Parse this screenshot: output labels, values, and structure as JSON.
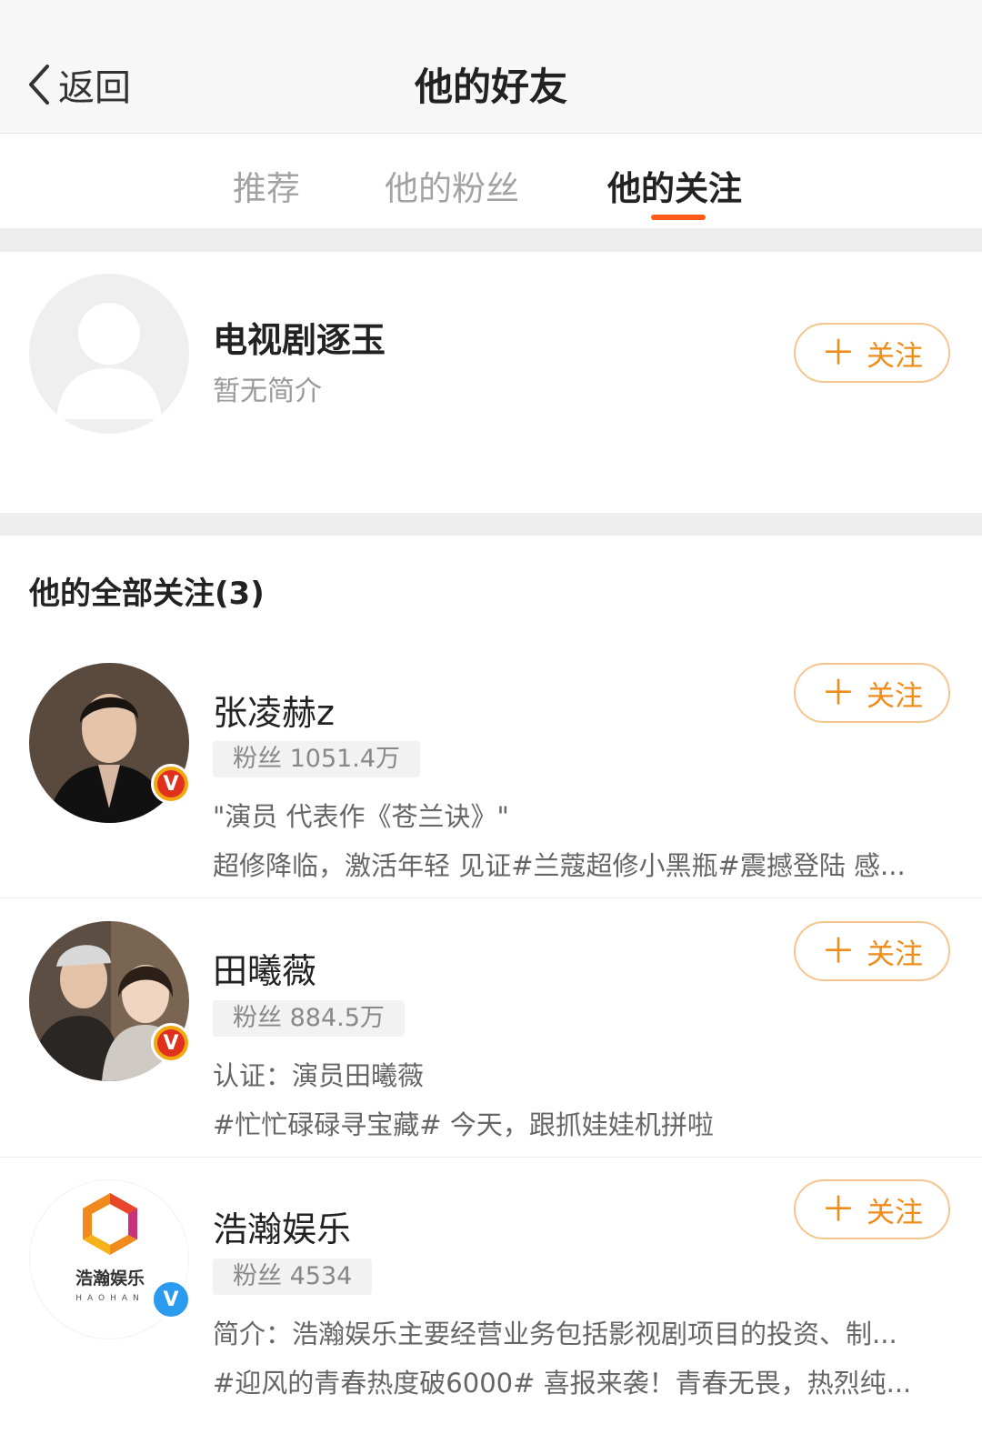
{
  "nav": {
    "back_label": "返回",
    "title": "他的好友"
  },
  "tabs": [
    {
      "label": "推荐"
    },
    {
      "label": "他的粉丝"
    },
    {
      "label": "他的关注",
      "active": true
    }
  ],
  "recommend": {
    "name": "电视剧逐玉",
    "bio": "暂无简介",
    "follow_label": "关注"
  },
  "following": {
    "title": "他的全部关注(3)",
    "items": [
      {
        "name": "张凌赫z",
        "fans": "粉丝 1051.4万",
        "desc": "\"演员 代表作《苍兰诀》\"",
        "latest": "超修降临，激活年轻 见证#兰蔻超修小黑瓶#震撼登陆 感...",
        "verified": "gold",
        "follow_label": "关注"
      },
      {
        "name": "田曦薇",
        "fans": "粉丝 884.5万",
        "desc": "认证：演员田曦薇",
        "latest": "#忙忙碌碌寻宝藏# 今天，跟抓娃娃机拼啦",
        "verified": "gold",
        "follow_label": "关注"
      },
      {
        "name": "浩瀚娱乐",
        "fans": "粉丝 4534",
        "desc": "简介：浩瀚娱乐主要经营业务包括影视剧项目的投资、制...",
        "latest": "#迎风的青春热度破6000# 喜报来袭！青春无畏，热烈纯...",
        "verified": "blue",
        "follow_label": "关注",
        "logo_text": "浩瀚娱乐",
        "logo_sub": "HAOHAN"
      }
    ]
  },
  "colors": {
    "accent": "#ff5a19",
    "follow_text": "#f08c1a",
    "follow_border": "#f5c68f"
  },
  "icons": {
    "back": "chevron-left-icon",
    "plus": "plus-icon",
    "verified_gold": "verified-v-gold-icon",
    "verified_blue": "verified-v-blue-icon"
  }
}
